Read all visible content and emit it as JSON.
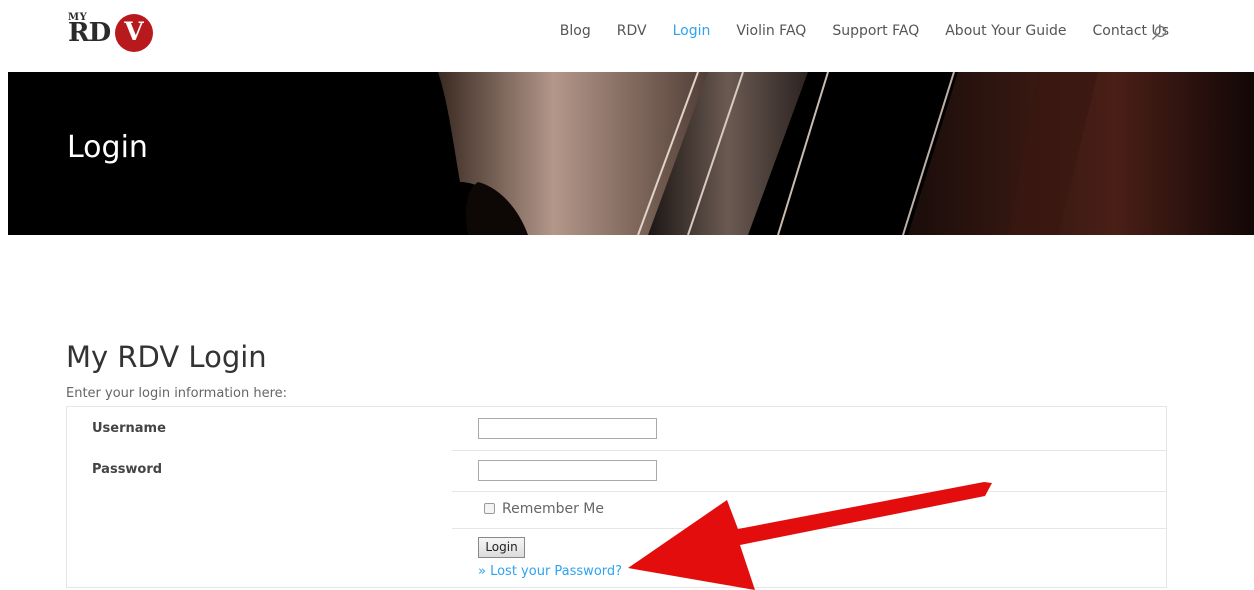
{
  "header": {
    "logo": {
      "my": "MY",
      "rd": "RD",
      "v": "V"
    },
    "nav": [
      "Blog",
      "RDV",
      "Login",
      "Violin FAQ",
      "Support FAQ",
      "About Your Guide",
      "Contact Us"
    ],
    "active_nav": "Login",
    "search_icon": "search-icon"
  },
  "hero": {
    "title": "Login"
  },
  "main": {
    "title": "My RDV Login",
    "intro": "Enter your login information here:",
    "form": {
      "username_label": "Username",
      "username_value": "",
      "password_label": "Password",
      "password_value": "",
      "remember_label": "Remember Me",
      "remember_checked": false,
      "login_button": "Login",
      "lost_password": "» Lost your Password?"
    }
  },
  "annotation": {
    "arrow_icon": "red-arrow-icon",
    "color": "#e30d0d"
  },
  "colors": {
    "accent": "#2ea3f2",
    "brand": "#b8191c"
  }
}
